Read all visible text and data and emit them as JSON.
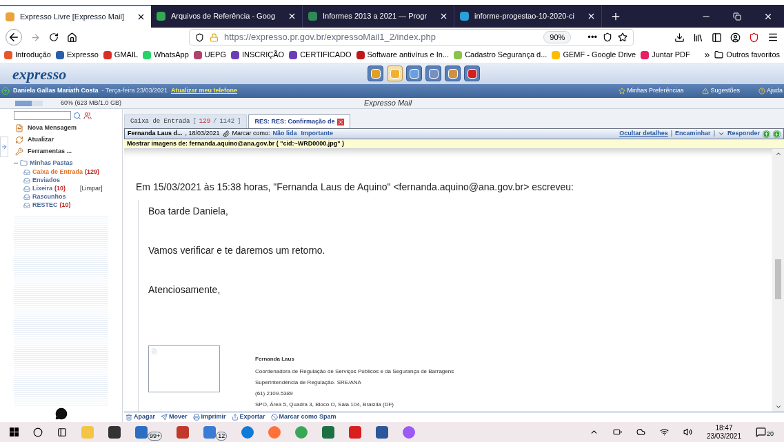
{
  "browser": {
    "tabs": [
      {
        "title": "Expresso Livre [Expresso Mail]",
        "selected": true,
        "color": "#e8a33a"
      },
      {
        "title": "Arquivos de Referência - Goog",
        "selected": false,
        "color": "#34a853"
      },
      {
        "title": "Informes 2013 a 2021 — Progr",
        "selected": false,
        "color": "#2e8b57"
      },
      {
        "title": "informe-progestao-10-2020-ci",
        "selected": false,
        "color": "#2a9fd8"
      }
    ],
    "url_host": "https://expresso.pr.gov.br",
    "url_path": "/expressoMail1_2/index.php",
    "zoom": "90%",
    "page_actions": "•••",
    "bookmarks": [
      {
        "label": "Introdução",
        "color": "#e8562a"
      },
      {
        "label": "Expresso",
        "color": "#2a5ea8"
      },
      {
        "label": "GMAIL",
        "color": "#d93025"
      },
      {
        "label": "WhatsApp",
        "color": "#25d366"
      },
      {
        "label": "UEPG",
        "color": "#b0426e"
      },
      {
        "label": "INSCRIÇÃO",
        "color": "#6a3fb5"
      },
      {
        "label": "CERTIFICADO",
        "color": "#6a3fb5"
      },
      {
        "label": "Software antivírus e In...",
        "color": "#c01818"
      },
      {
        "label": "Cadastro Segurança d...",
        "color": "#8bc34a"
      },
      {
        "label": "GEMF - Google Drive",
        "color": "#fbbc04"
      },
      {
        "label": "Juntar PDF",
        "color": "#e91e63"
      }
    ],
    "overflow": "»",
    "other_bookmarks": "Outros favoritos"
  },
  "app": {
    "logo": "expresso",
    "toolbar": [
      {
        "kind": "grid",
        "selected": false
      },
      {
        "kind": "envelope",
        "selected": true
      },
      {
        "kind": "card",
        "selected": false
      },
      {
        "kind": "book",
        "selected": false
      },
      {
        "kind": "pages",
        "selected": false
      },
      {
        "kind": "power",
        "selected": false
      }
    ],
    "user": "Daniela Gallas Mariath Costa",
    "date": "- Terça-feira 23/03/2021",
    "phone_link": "Atualizar meu telefone",
    "links": [
      "Minhas Preferências",
      "Sugestões",
      "Ajuda"
    ],
    "quota": {
      "text": "60% (623 MB/1.0 GB)",
      "level": 0.6
    },
    "title": "Expresso Mail"
  },
  "sidebar": {
    "actions": [
      {
        "kind": "new",
        "label": "Nova Mensagem"
      },
      {
        "kind": "refresh",
        "label": "Atualizar"
      },
      {
        "kind": "tools",
        "label": "Ferramentas ..."
      }
    ],
    "tree": {
      "label": "Minhas Pastas",
      "expanded": true,
      "children": [
        {
          "label": "Caixa de Entrada",
          "count": "(129)",
          "selected": true
        },
        {
          "label": "Enviados",
          "selected": false
        },
        {
          "label": "Lixeira",
          "count": "(10)",
          "action": "[Limpar]",
          "selected": false
        },
        {
          "label": "Rascunhos",
          "selected": false
        },
        {
          "label": "RESTEC",
          "count": "(10)",
          "selected": false
        }
      ]
    }
  },
  "mail_tabs": [
    {
      "label": "Caixa de Entrada",
      "open": "[",
      "unread": "129",
      "separator": "/",
      "total": "1142",
      "close": "]",
      "selected": false
    },
    {
      "label": "RES: RES: Confirmação de",
      "selected": true
    }
  ],
  "message": {
    "sender": "Fernanda Laus d...",
    "date": ", 18/03/2021",
    "mark_label": "Marcar como:",
    "mark_links": [
      "Não lida",
      "Importante"
    ],
    "actions": [
      "Ocultar detalhes",
      "Encaminhar",
      "Responder"
    ],
    "separator": "|",
    "show_images": "Mostrar imagens de: fernanda.aquino@ana.gov.br ( \"cid:~WRD0000.jpg\" )",
    "quote_header": "Em 15/03/2021 às 15:38 horas, \"Fernanda Laus de Aquino\" <fernanda.aquino@ana.gov.br> escreveu:",
    "paragraphs": [
      "Boa tarde Daniela,",
      "Vamos verificar e te daremos um retorno.",
      "Atenciosamente,"
    ],
    "signature": {
      "name": "Fernanda Laus",
      "lines": [
        "Coordenadora de Regulação de Serviços Públicos e da Segurança de Barragens",
        "Superintendência de Regulação- SRE/ANA",
        "(61) 2109-5389",
        "SPO, Área 5, Quadra 3, Bloco O, Sala 104, Brasília (DF)"
      ]
    }
  },
  "bottom_actions": [
    "Apagar",
    "Mover",
    "Imprimir",
    "Exportar",
    "Marcar como Spam"
  ],
  "taskbar": {
    "apps": [
      {
        "kind": "explorer"
      },
      {
        "kind": "store"
      },
      {
        "kind": "mail",
        "badge": "99+"
      },
      {
        "kind": "gift"
      },
      {
        "kind": "phone",
        "badge": "12"
      },
      {
        "kind": "edge"
      },
      {
        "kind": "firefox"
      },
      {
        "kind": "chrome"
      },
      {
        "kind": "excel"
      },
      {
        "kind": "acrobat"
      },
      {
        "kind": "word"
      },
      {
        "kind": "flame"
      }
    ],
    "time": "18:47",
    "date": "23/03/2021",
    "notifications": "20"
  }
}
